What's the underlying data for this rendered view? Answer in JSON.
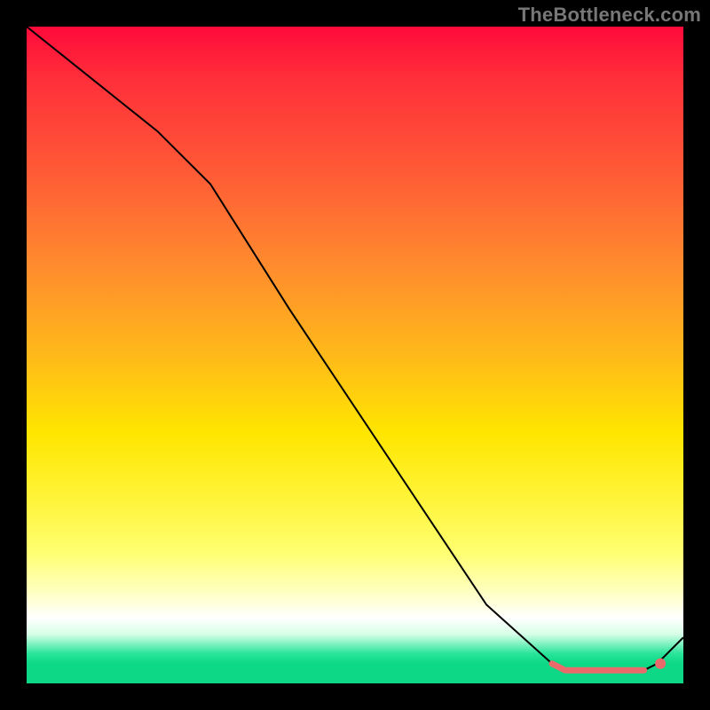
{
  "watermark": "TheBottleneck.com",
  "chart_data": {
    "type": "line",
    "title": "",
    "xlabel": "",
    "ylabel": "",
    "xlim": [
      0,
      100
    ],
    "ylim": [
      0,
      100
    ],
    "grid": false,
    "legend": false,
    "series": [
      {
        "name": "curve",
        "stroke": "#000000",
        "stroke_width": 2,
        "x": [
          0,
          10,
          20,
          28,
          40,
          50,
          60,
          70,
          80,
          82,
          85,
          88,
          91,
          94,
          96,
          100
        ],
        "y": [
          100,
          92,
          84,
          76,
          57,
          42,
          27,
          12,
          3,
          2,
          2,
          2,
          2,
          2,
          3,
          7
        ]
      },
      {
        "name": "highlight-segment",
        "stroke": "#e96a6a",
        "stroke_width": 7,
        "linecap": "round",
        "x": [
          80,
          82,
          85,
          88,
          91,
          94
        ],
        "y": [
          3,
          2,
          2,
          2,
          2,
          2
        ]
      }
    ],
    "markers": [
      {
        "name": "highlight-dot",
        "x": 96.5,
        "y": 3,
        "r": 6,
        "fill": "#e96a6a"
      }
    ]
  },
  "colors": {
    "black": "#000000",
    "highlight": "#e96a6a",
    "watermark": "#777777"
  }
}
